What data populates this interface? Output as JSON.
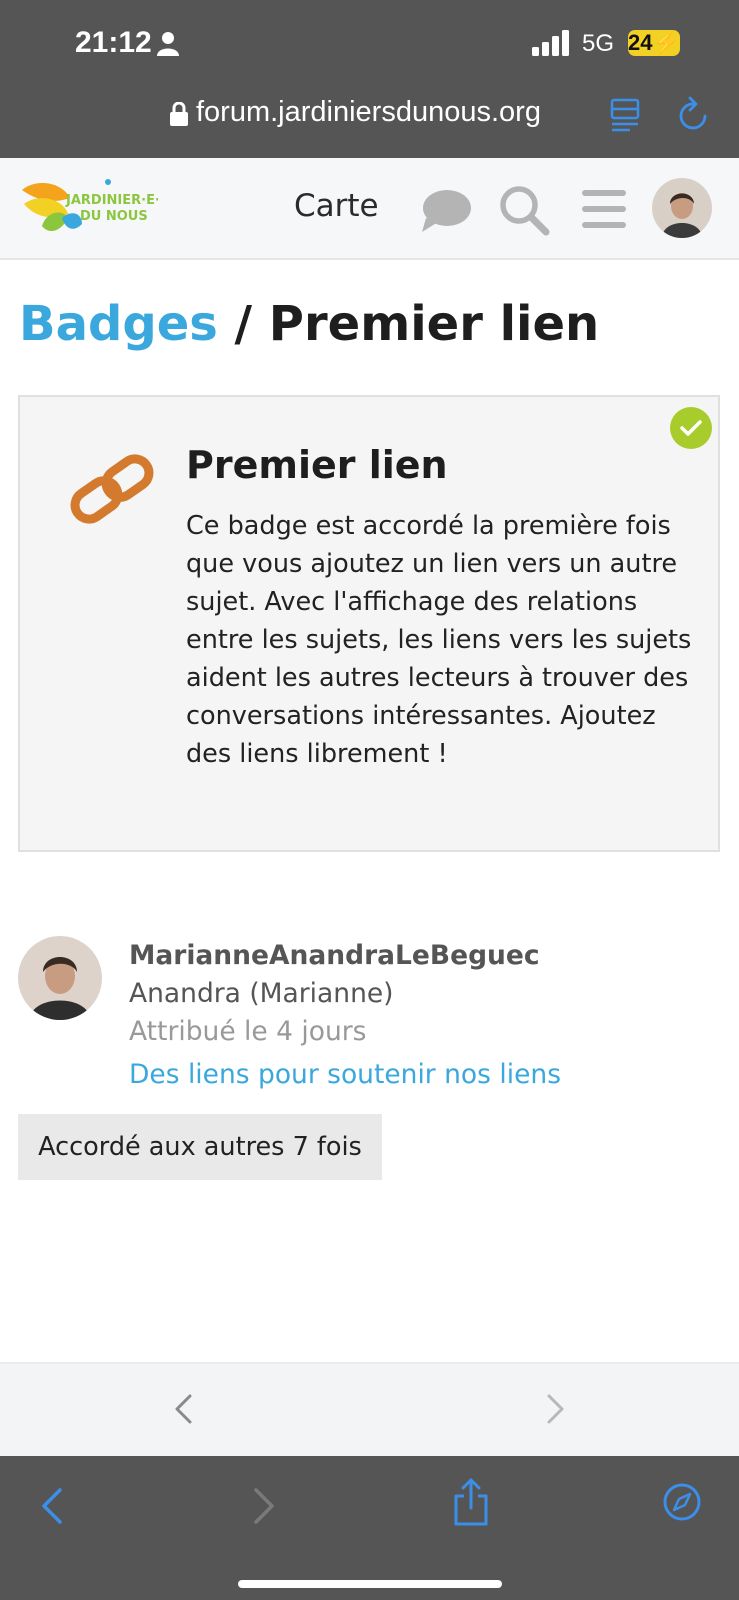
{
  "status": {
    "time": "21:12",
    "network": "5G",
    "battery": "24"
  },
  "browser": {
    "url": "forum.jardiniersdunous.org"
  },
  "header": {
    "logo_line1": "JARDINIER·E·S",
    "logo_line2": "DU NOUS",
    "map_link": "Carte"
  },
  "breadcrumb": {
    "link": "Badges",
    "separator": " / ",
    "current": "Premier lien"
  },
  "badge": {
    "title": "Premier lien",
    "description": "Ce badge est accordé la première fois que vous ajoutez un lien vers un autre sujet. Avec l'affichage des relations entre les sujets, les liens vers les sujets aident les autres lecteurs à trouver des conversations intéressantes. Ajoutez des liens librement !",
    "icon": "link-icon",
    "granted_icon": "check-icon",
    "color": "#d37a2e"
  },
  "grant": {
    "username": "MarianneAnandraLeBeguec",
    "name": "Anandra (Marianne)",
    "granted_time": "Attribué le 4 jours",
    "topic": "Des liens pour soutenir nos liens"
  },
  "others_button": "Accordé aux autres 7 fois",
  "colors": {
    "accent": "#3aa8dc",
    "check": "#a8cc2c",
    "chrome": "#555555",
    "ios_blue": "#3b8fe8"
  }
}
